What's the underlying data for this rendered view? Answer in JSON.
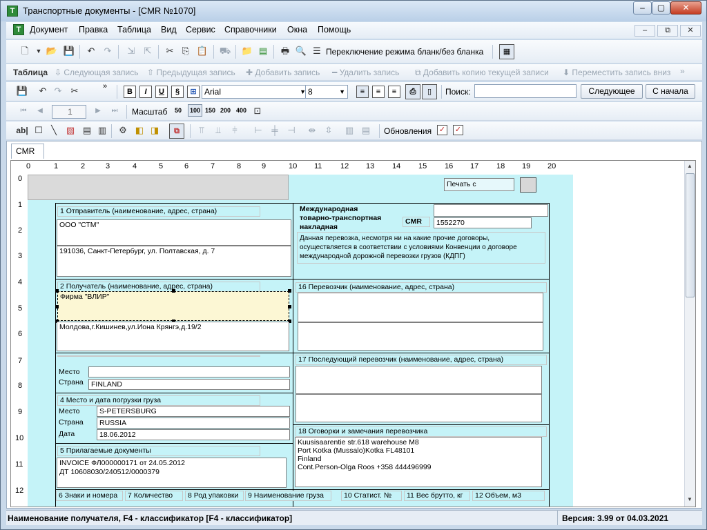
{
  "window": {
    "title": "Транспортные документы - [CMR №1070]",
    "minimize": "‒",
    "maximize": "▢",
    "close": "✕"
  },
  "menu": {
    "items": [
      "Документ",
      "Правка",
      "Таблица",
      "Вид",
      "Сервис",
      "Справочники",
      "Окна",
      "Помощь"
    ],
    "mdi_min": "‒",
    "mdi_restore": "⧉",
    "mdi_close": "✕"
  },
  "toolbar1": {
    "mode_toggle": "Переключение режима бланк/без бланка"
  },
  "toolbar2": {
    "table": "Таблица",
    "next_record": "Следующая запись",
    "prev_record": "Предыдущая запись",
    "add_record": "Добавить запись",
    "delete_record": "Удалить запись",
    "add_copy": "Добавить копию текущей записи",
    "move_down": "Переместить запись вниз"
  },
  "toolbar3": {
    "font": "Arial",
    "size": "8",
    "search_label": "Поиск:",
    "search_value": "",
    "next_button": "Следующее",
    "from_start_button": "С начала"
  },
  "toolbar4": {
    "page": "1",
    "scale_label": "Масштаб",
    "zoom": [
      "50",
      "100",
      "150",
      "200",
      "400"
    ]
  },
  "toolbar5": {
    "updates_label": "Обновления"
  },
  "doc_tab": "CMR",
  "ruler": {
    "cols": [
      "0",
      "1",
      "2",
      "3",
      "4",
      "5",
      "6",
      "7",
      "8",
      "9",
      "10",
      "11",
      "12",
      "13",
      "14",
      "15",
      "16",
      "17",
      "18",
      "19",
      "20"
    ],
    "rows": [
      "0",
      "1",
      "2",
      "3",
      "4",
      "5",
      "6",
      "7",
      "8",
      "9",
      "10",
      "11",
      "12"
    ]
  },
  "form": {
    "print_emblem": "Печать с эмблемой",
    "sender_label": "1 Отправитель (наименование, адрес, страна)",
    "sender_name": "ООО \"СТМ\"",
    "sender_address": "191036, Санкт-Петербург, ул. Полтавская, д. 7",
    "title_line1": "Международная",
    "title_line2": "товарно-транспортная",
    "title_line3": "накладная",
    "cmr_label": "CMR",
    "cmr_number": "1552270",
    "notice_1": "Данная перевозка, несмотря ни на какие прочие договоры,",
    "notice_2": "осуществляется в соответствии с условиями Конвенции о договоре",
    "notice_3": "международной дорожной перевозки грузов (КДПГ)",
    "consignee_label": "2 Получатель (наименование, адрес, страна)",
    "consignee_name": "Фирма \"ВЛИР\"",
    "consignee_address": "Молдова,г.Кишинев,ул.Иона Крянгэ,д.19/2",
    "carrier_label": "16 Перевозчик (наименование, адрес, страна)",
    "place_label": "Место",
    "country_label": "Страна",
    "date_label": "Дата",
    "delivery_country": "FINLAND",
    "next_carrier_label": "17 Последующий перевозчик (наименование, адрес, страна)",
    "loading_label": "4 Место и дата погрузки груза",
    "loading_place": "S-PETERSBURG",
    "loading_country": "RUSSIA",
    "loading_date": "18.06.2012",
    "remarks_label": "18 Оговорки и замечания перевозчика",
    "remarks_1": "Kuusisaarentie str.618 warehouse M8",
    "remarks_2": "Port Kotka (Mussalo)Kotka FL48101",
    "remarks_3": "Finland",
    "remarks_4": "Cont.Person-Olga Roos +358 444496999",
    "docs_label": "5 Прилагаемые документы",
    "docs_1": "INVOICE ФЛ000000171 от 24.05.2012",
    "docs_2": "ДТ 10608030/240512/0000379",
    "col6": "6 Знаки и номера",
    "col7": "7 Количество",
    "col8": "8 Род упаковки",
    "col9": "9 Наименование груза",
    "col10": "10 Статист. №",
    "col11": "11 Вес брутто, кг",
    "col12": "12 Объем, м3"
  },
  "status": {
    "hint": "Наименование получателя, F4 - классификатор [F4 - классификатор]",
    "version": "Версия: 3.99 от 04.03.2021"
  }
}
